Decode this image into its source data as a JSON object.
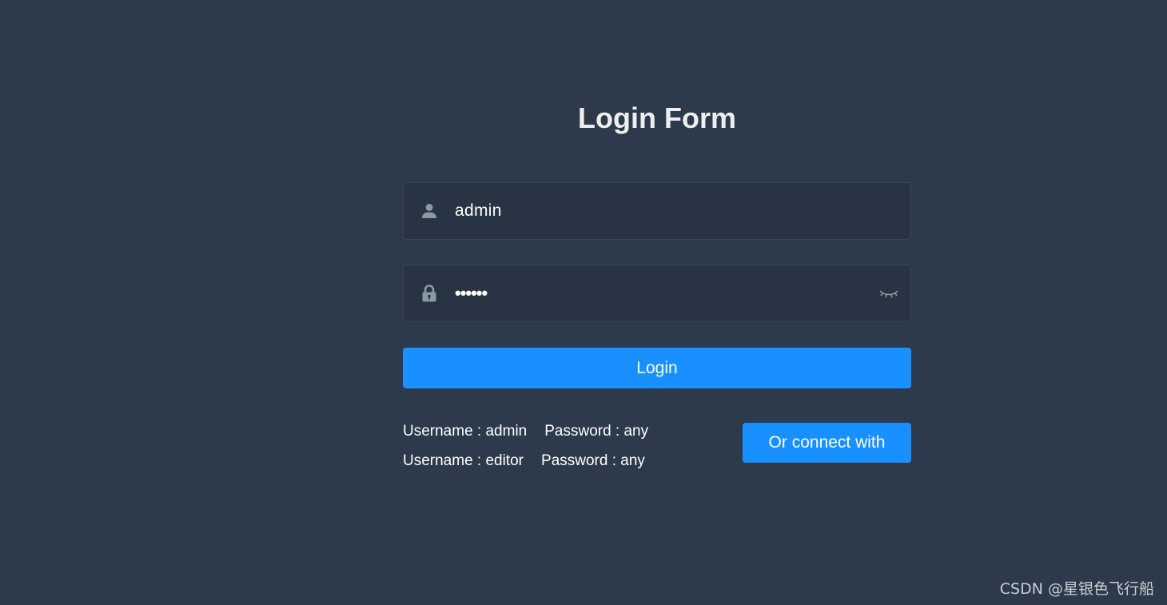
{
  "title": "Login Form",
  "username_field": {
    "icon": "user-icon",
    "value": "admin"
  },
  "password_field": {
    "icon": "lock-icon",
    "value": "••••••",
    "toggle_icon": "eye-closed-icon"
  },
  "login_button": {
    "label": "Login"
  },
  "hints": [
    {
      "username": "Username : admin",
      "password": "Password : any"
    },
    {
      "username": "Username : editor",
      "password": "Password : any"
    }
  ],
  "connect_button": {
    "label": "Or connect with"
  },
  "watermark": "CSDN @星银色飞行船",
  "colors": {
    "background": "#2d3a4b",
    "field_background": "#283443",
    "accent": "#1890ff",
    "icon": "#889aa4",
    "text": "#ffffff",
    "title": "#eeeeee"
  }
}
